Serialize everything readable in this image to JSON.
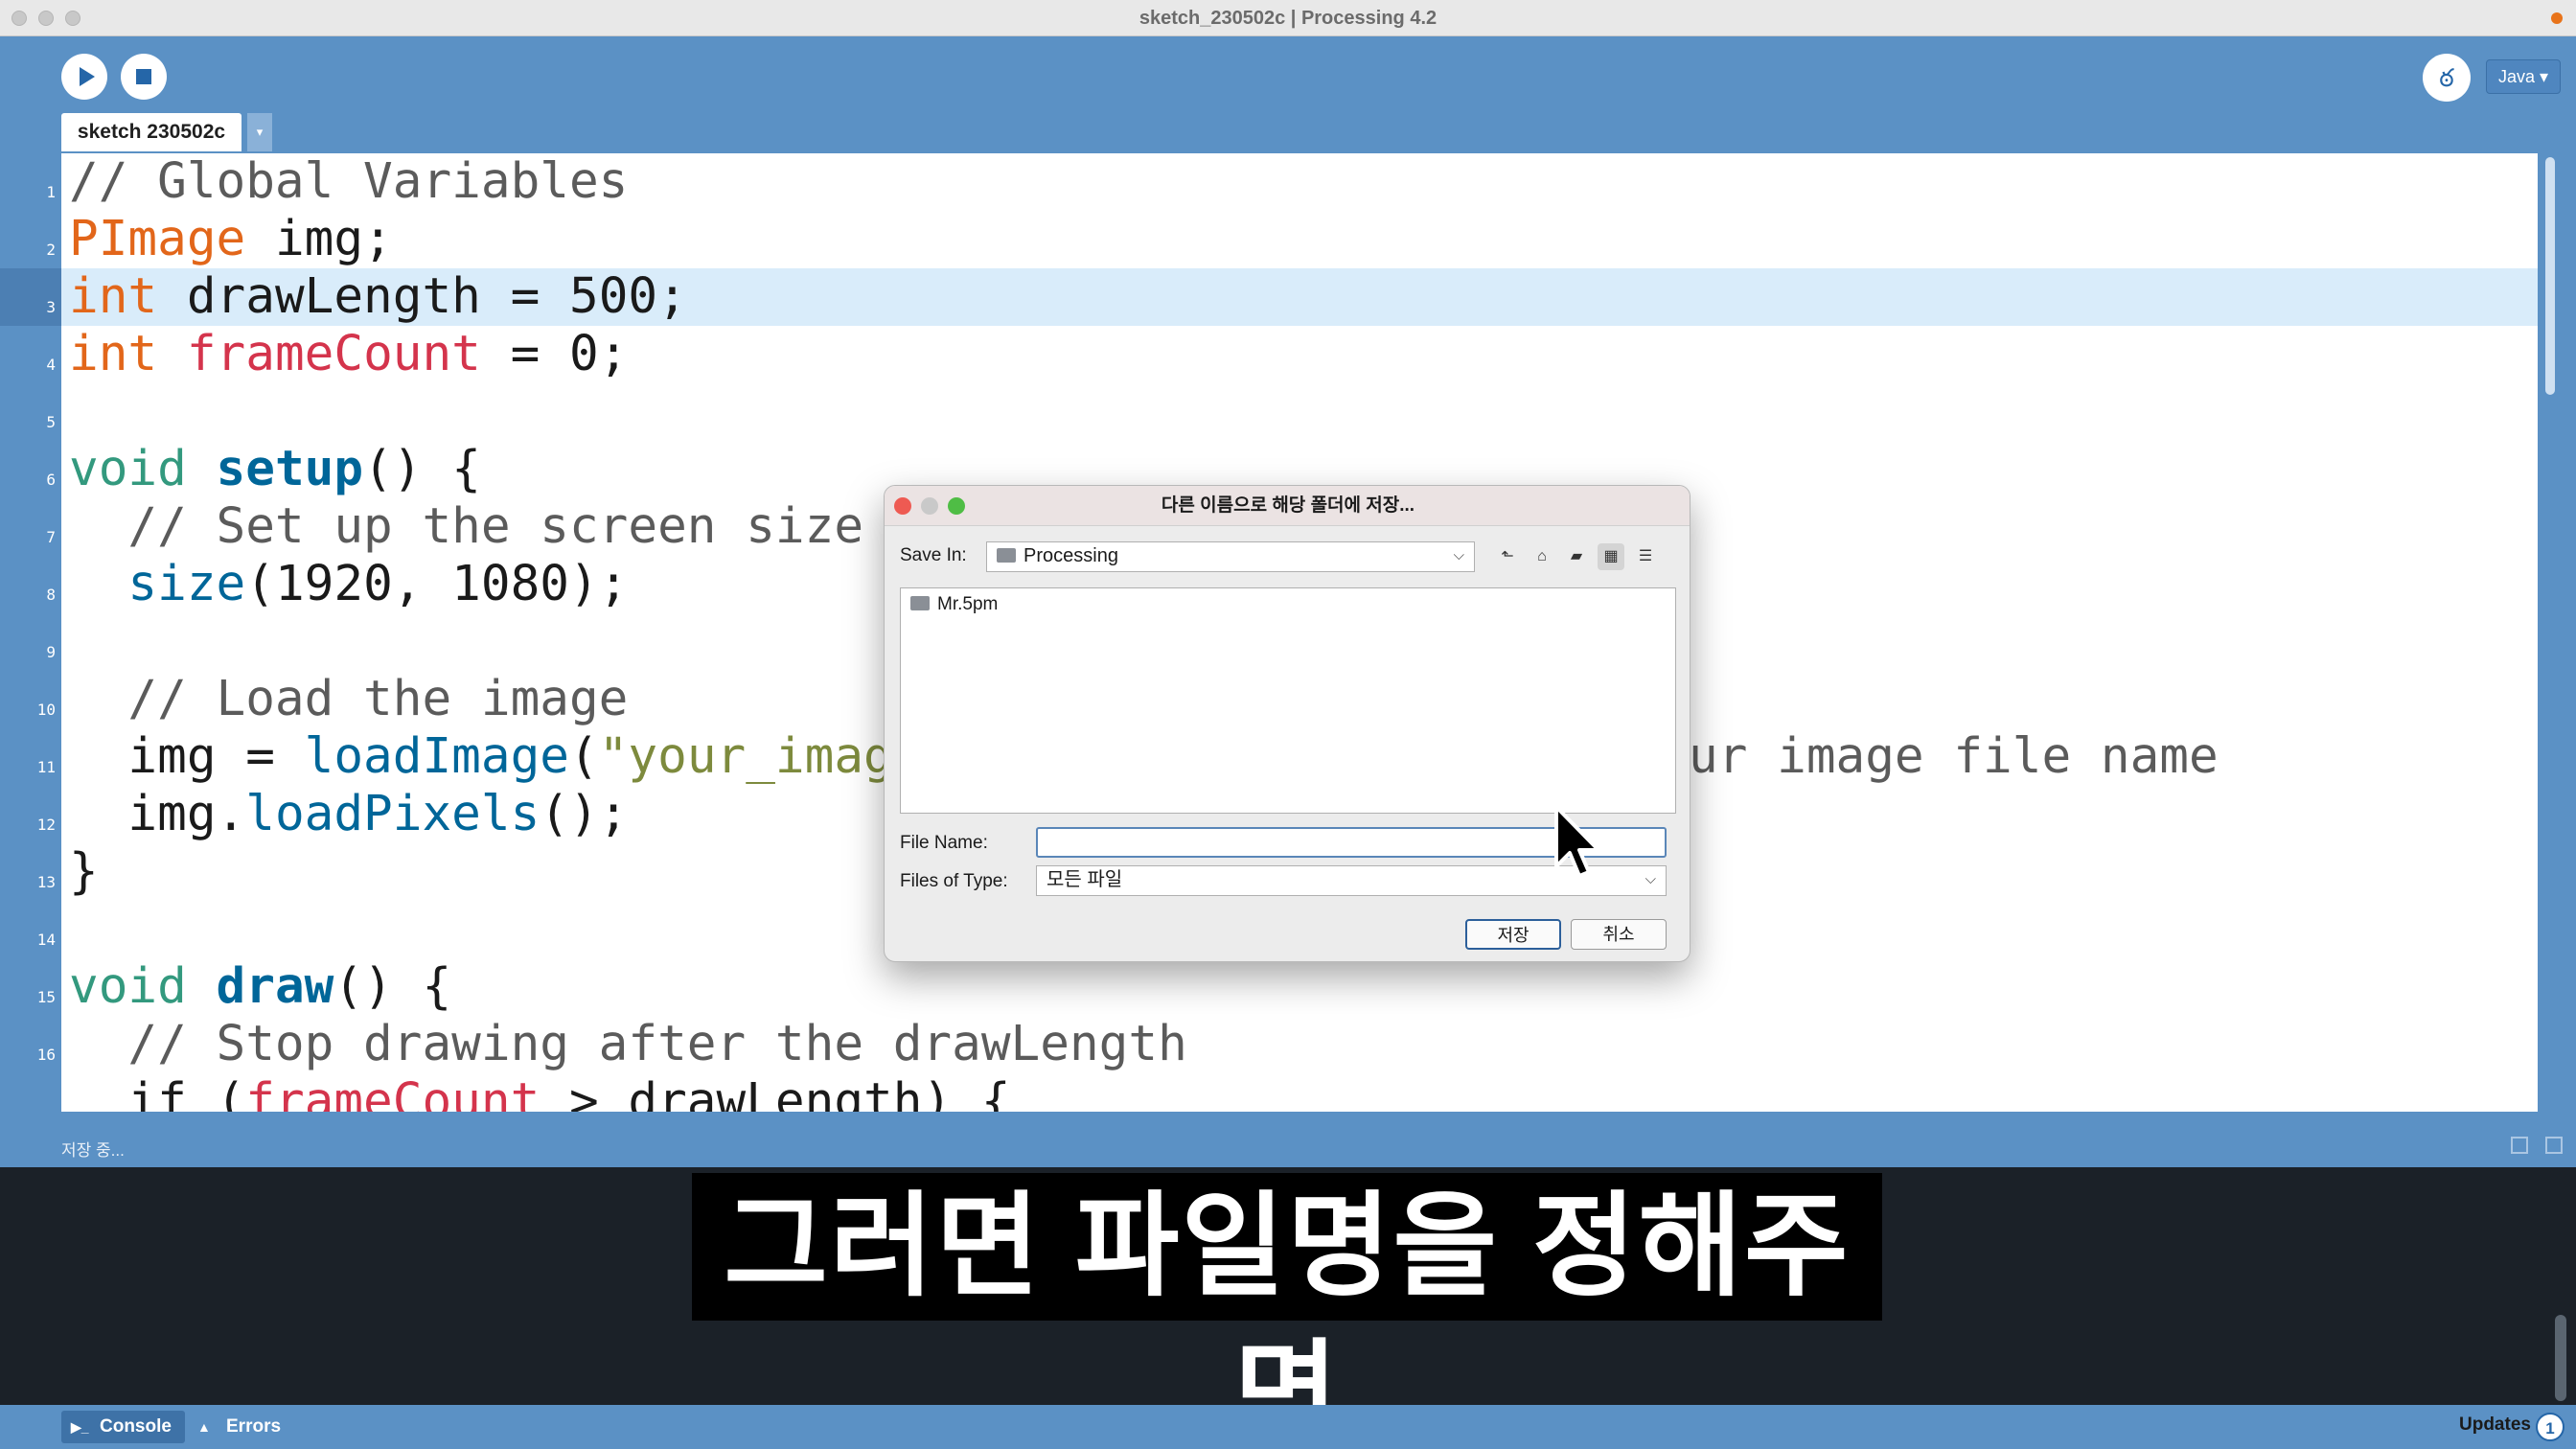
{
  "window": {
    "title": "sketch_230502c | Processing 4.2"
  },
  "toolbar": {
    "mode": "Java ▾",
    "debug_glyph": "ఠ"
  },
  "tab": {
    "label": "sketch 230502c",
    "arrow": "▾"
  },
  "editor": {
    "line_numbers": [
      "1",
      "2",
      "3",
      "4",
      "5",
      "6",
      "7",
      "8",
      "9",
      "10",
      "11",
      "12",
      "13",
      "14",
      "15",
      "16"
    ],
    "lines": {
      "l1": {
        "comment": "// Global Variables"
      },
      "l2": {
        "type": "PImage",
        "rest": " img;"
      },
      "l3": {
        "type": "int",
        "rest": " drawLength = 500;"
      },
      "l4": {
        "type": "int",
        "space": " ",
        "var": "frameCount",
        "rest": " = 0;"
      },
      "l6": {
        "void": "void",
        "space": " ",
        "fn": "setup",
        "rest": "() {"
      },
      "l7": {
        "comment": "  // Set up the screen size"
      },
      "l8": {
        "indent": "  ",
        "call": "size",
        "rest": "(1920, 1080);"
      },
      "l10": {
        "comment": "  // Load the image"
      },
      "l11": {
        "pre": "  img = ",
        "call": "loadImage",
        "paren": "(",
        "str": "\"your_imag",
        "tail": "ur image file name"
      },
      "l12": {
        "pre": "  img.",
        "call": "loadPixels",
        "rest": "();"
      },
      "l13": {
        "text": "}"
      },
      "l15": {
        "void": "void",
        "space": " ",
        "fn": "draw",
        "rest": "() {"
      },
      "l16": {
        "comment": "  // Stop drawing after the drawLength"
      },
      "l17": {
        "pre": "  if (",
        "var": "frameCount",
        "rest": " > drawLength) {"
      }
    }
  },
  "status": {
    "text": "저장 중..."
  },
  "footer": {
    "console": "Console",
    "errors": "Errors",
    "updates": "Updates",
    "updates_count": "1"
  },
  "subtitle": "그러면 파일명을 정해주면",
  "dialog": {
    "title": "다른 이름으로 해당 폴더에 저장...",
    "save_in_label": "Save In:",
    "save_in_value": "Processing",
    "files": [
      "Mr.5pm"
    ],
    "file_name_label": "File Name:",
    "file_name_value": "",
    "files_of_type_label": "Files of Type:",
    "files_of_type_value": "모든 파일",
    "save_button": "저장",
    "cancel_button": "취소"
  }
}
